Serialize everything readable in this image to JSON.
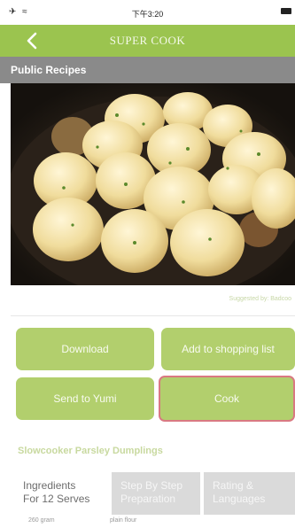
{
  "status_bar": {
    "left_icons": "✈ ≈",
    "time": "下午3:20"
  },
  "navbar": {
    "back_icon": "chevron-left-icon",
    "brand": "SUPER COOK"
  },
  "section": {
    "title": "Public Recipes"
  },
  "recipe": {
    "suggested_by": "Suggested by: Badcoo",
    "title": "Slowcooker Parsley Dumplings"
  },
  "actions": {
    "download": "Download",
    "shopping_list": "Add to shopping list",
    "send_to_yumi": "Send to Yumi",
    "cook": "Cook"
  },
  "tabs": {
    "ingredients_line1": "Ingredients",
    "ingredients_line2": "For 12 Serves",
    "steps_line1": "Step By Step",
    "steps_line2": "Preparation",
    "rating_line1": "Rating &",
    "rating_line2": "Languages"
  },
  "ingredients": [
    {
      "quantity": "260 gram",
      "name": "plain flour"
    }
  ],
  "colors": {
    "brand_green": "#9bc44f",
    "button_green": "#b2cf6d",
    "header_gray": "#8a8a8a",
    "selected_border": "#d97982"
  }
}
